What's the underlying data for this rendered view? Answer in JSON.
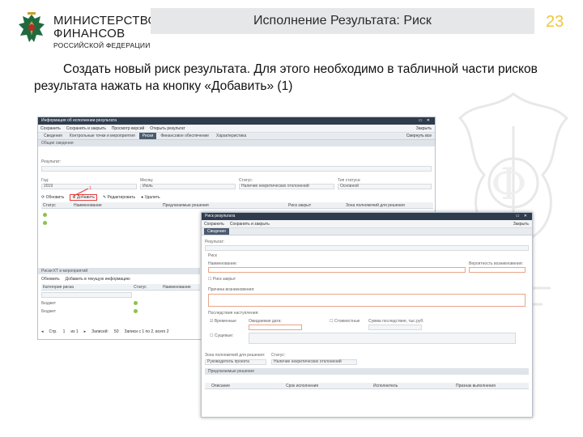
{
  "slide": {
    "ministry_line1": "МИНИСТЕРСТВО",
    "ministry_line2": "ФИНАНСОВ",
    "ministry_line3": "РОССИЙСКОЙ ФЕДЕРАЦИИ",
    "title": "Исполнение Результата: Риск",
    "page_number": "23",
    "instruction": "Создать новый риск результата. Для этого необходимо в табличной части рисков результата нажать на кнопку «Добавить» (1)"
  },
  "colors": {
    "title_bar": "#e6e7e8",
    "page_number": "#f0c63c",
    "window_titlebar": "#2f3c4d",
    "highlight": "#e53935",
    "status_ok": "#8bc34a"
  },
  "window1": {
    "title": "Информация об исполнении результата",
    "toolbar": [
      "Сохранить",
      "Сохранить и закрыть",
      "Просмотр версий",
      "Открыть результат"
    ],
    "toolbar_right": "Закрыть",
    "tabs": [
      "Сведения",
      "Контрольные точки и мероприятия",
      "Риски",
      "Финансовое обеспечение",
      "Характеристика"
    ],
    "active_tab": "Риски",
    "tabs_right": "Свернуть все",
    "section_general": "Общие сведения",
    "result_label": "Результат:",
    "year_label": "Год:",
    "year_value": "2019",
    "month_label": "Месяц:",
    "month_value": "Июль",
    "status_label": "Статус:",
    "status_value": "Наличие некритических отклонений",
    "type_label": "Тип статуса:",
    "type_value": "Основной",
    "grid_toolbar": [
      "Обновить",
      "Добавить",
      "Редактировать",
      "Удалить"
    ],
    "marker": "1",
    "grid_columns": [
      "Статус",
      "Наименование",
      "Предлагаемые решения",
      "Риск закрыт",
      "Зона полномочий для решения"
    ],
    "section_kt": "Риски КТ и мероприятий",
    "kt_toolbar": [
      "Обновить",
      "Добавить в текущую информацию"
    ],
    "kt_columns": [
      "Категория риска",
      "Статус",
      "Наименование"
    ],
    "kt_rows": [
      "Бюджет",
      "Бюджет"
    ],
    "pager": {
      "page_label": "Стр.",
      "page": "1",
      "of": "из 1",
      "records_label": "Записей:",
      "records": "50",
      "range": "Записи с 1 по 2, всего 2"
    }
  },
  "window2": {
    "title": "Риск результата",
    "toolbar": [
      "Сохранить",
      "Сохранить и закрыть"
    ],
    "toolbar_right": "Закрыть",
    "tab": "Сведения",
    "result_label": "Результат:",
    "section_risk": "Риск",
    "name_label": "Наименование:",
    "probability_label": "Вероятность возникновения:",
    "closed_label": "Риск закрыт",
    "cause_label": "Причина возникновения:",
    "consequences_label": "Последствия наступления:",
    "temporary_label": "Временные",
    "expected_date_label": "Ожидаемая дата:",
    "cost_label": "Стоимостные",
    "sum_label": "Сумма последствия, тыс.руб:",
    "other_label": "Сущевые:",
    "zone_label": "Зона полномочий для решения:",
    "zone_value": "Руководитель проекта",
    "status_label": "Статус:",
    "status_value": "Наличие некритических отклонений",
    "solutions_section": "Предлагаемые решения",
    "sol_columns": [
      "Описание",
      "Срок исполнения",
      "Исполнитель",
      "Признак выполнения"
    ]
  }
}
